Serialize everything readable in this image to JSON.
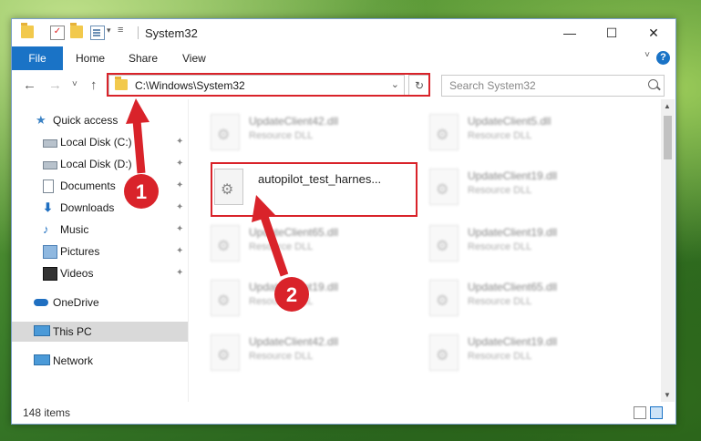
{
  "window": {
    "title": "System32",
    "controls": {
      "minimize": "—",
      "maximize": "☐",
      "close": "✕"
    }
  },
  "ribbon": {
    "file_tab": "File",
    "tabs": [
      "Home",
      "Share",
      "View"
    ],
    "help": "?",
    "expand": "˅"
  },
  "address_bar": {
    "path": "C:\\Windows\\System32",
    "dropdown": "⌄",
    "refresh": "↻",
    "search_placeholder": "Search System32",
    "back": "←",
    "forward": "→",
    "recent": "˅",
    "up": "↑"
  },
  "sidebar": {
    "quick_access": "Quick access",
    "items": [
      {
        "label": "Local Disk (C:)",
        "icon": "drive-icon",
        "pinned": true
      },
      {
        "label": "Local Disk (D:)",
        "icon": "drive-icon",
        "pinned": true
      },
      {
        "label": "Documents",
        "icon": "documents-icon",
        "pinned": true
      },
      {
        "label": "Downloads",
        "icon": "downloads-icon",
        "pinned": true
      },
      {
        "label": "Music",
        "icon": "music-icon",
        "pinned": true
      },
      {
        "label": "Pictures",
        "icon": "pictures-icon",
        "pinned": true
      },
      {
        "label": "Videos",
        "icon": "videos-icon",
        "pinned": true
      }
    ],
    "onedrive": "OneDrive",
    "this_pc": "This PC",
    "network": "Network",
    "pin_glyph": "📌"
  },
  "files": {
    "highlighted": {
      "name": "autopilot_test_harnes..."
    },
    "col1": [
      {
        "name": "UpdateClient42.dll",
        "type": "Resource DLL"
      },
      {
        "name": "UpdateClient65.dll",
        "type": "Resource DLL"
      },
      {
        "name": "UpdateClient19.dll",
        "type": "Resource DLL"
      },
      {
        "name": "UpdateClient42.dll",
        "type": "Resource DLL"
      }
    ],
    "col2": [
      {
        "name": "UpdateClient5.dll",
        "type": "Resource DLL"
      },
      {
        "name": "UpdateClient19.dll",
        "type": "Resource DLL"
      },
      {
        "name": "UpdateClient19.dll",
        "type": "Resource DLL"
      },
      {
        "name": "UpdateClient65.dll",
        "type": "Resource DLL"
      },
      {
        "name": "UpdateClient19.dll",
        "type": "Resource DLL"
      }
    ]
  },
  "status": {
    "item_count": "148 items"
  },
  "annotations": {
    "badge1": "1",
    "badge2": "2",
    "color": "#d9232a"
  }
}
